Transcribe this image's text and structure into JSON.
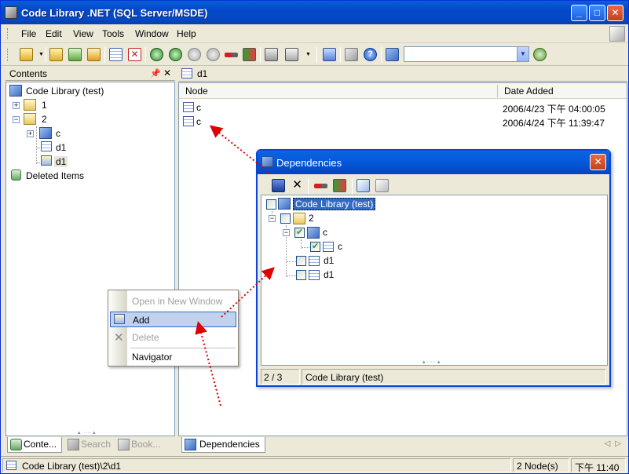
{
  "window": {
    "title": "Code Library .NET (SQL Server/MSDE)"
  },
  "menu": [
    "File",
    "Edit",
    "View",
    "Tools",
    "Window",
    "Help"
  ],
  "left_pane": {
    "title": "Contents",
    "tree": {
      "root": "Code Library (test)",
      "n1": "1",
      "n2": "2",
      "n2_c": "c",
      "n2_d1a": "d1",
      "n2_d1b": "d1",
      "deleted": "Deleted Items"
    },
    "tabs": [
      "Conte...",
      "Search",
      "Book..."
    ]
  },
  "document": {
    "tab": "d1",
    "columns": [
      "Node",
      "Date Added"
    ],
    "rows": [
      {
        "node": "c",
        "date": "2006/4/23 下午 04:00:05"
      },
      {
        "node": "c",
        "date": "2006/4/24 下午 11:39:47"
      }
    ],
    "bottom_tab": "Dependencies"
  },
  "dialog": {
    "title": "Dependencies",
    "tree": {
      "root": "Code Library (test)",
      "n2": "2",
      "c": "c",
      "c_child": "c",
      "d1a": "d1",
      "d1b": "d1"
    },
    "status_count": "2 / 3",
    "status_path": "Code Library (test)"
  },
  "context_menu": {
    "open_new": "Open in New Window",
    "add": "Add",
    "delete": "Delete",
    "navigator": "Navigator"
  },
  "status_bar": {
    "path": "Code Library (test)\\2\\d1",
    "nodes": "2 Node(s)",
    "time": "下午 11:40"
  },
  "colors": {
    "title_blue": "#0548c4",
    "highlight": "#316ac5",
    "arrow_red": "#e00000"
  }
}
